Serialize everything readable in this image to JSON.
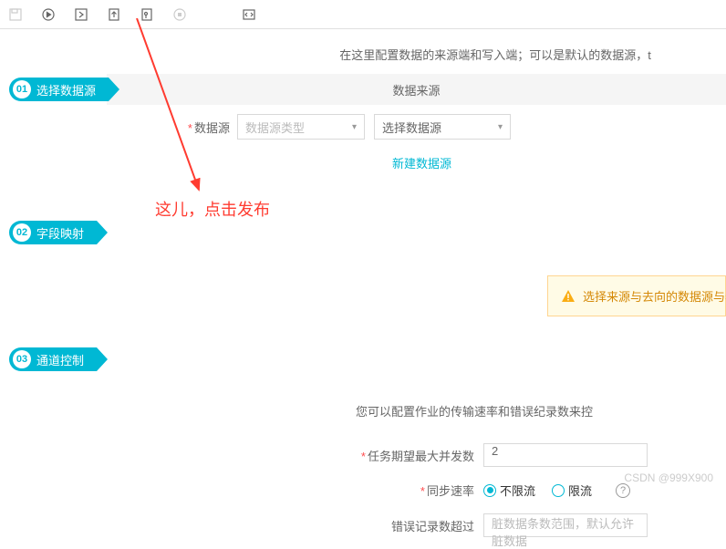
{
  "toolbar": {
    "icons": [
      "save-icon",
      "play-icon",
      "next-icon",
      "publish-icon",
      "format-icon",
      "stop-icon",
      "code-icon"
    ]
  },
  "intro": "在这里配置数据的来源端和写入端；可以是默认的数据源，t",
  "steps": {
    "s1": {
      "num": "01",
      "label": "选择数据源",
      "title": "数据来源"
    },
    "s2": {
      "num": "02",
      "label": "字段映射"
    },
    "s3": {
      "num": "03",
      "label": "通道控制"
    }
  },
  "source": {
    "label": "数据源",
    "typePlaceholder": "数据源类型",
    "selectPlaceholder": "选择数据源",
    "newLink": "新建数据源"
  },
  "annotation": "这儿，点击发布",
  "warning": "选择来源与去向的数据源与表",
  "channel": {
    "desc": "您可以配置作业的传输速率和错误纪录数来控",
    "maxConcLabel": "任务期望最大并发数",
    "maxConcValue": "2",
    "rateLabel": "同步速率",
    "rate1": "不限流",
    "rate2": "限流",
    "errLabel": "错误记录数超过",
    "errPlaceholder": "脏数据条数范围，默认允许脏数据"
  },
  "watermark": "CSDN @999X900"
}
